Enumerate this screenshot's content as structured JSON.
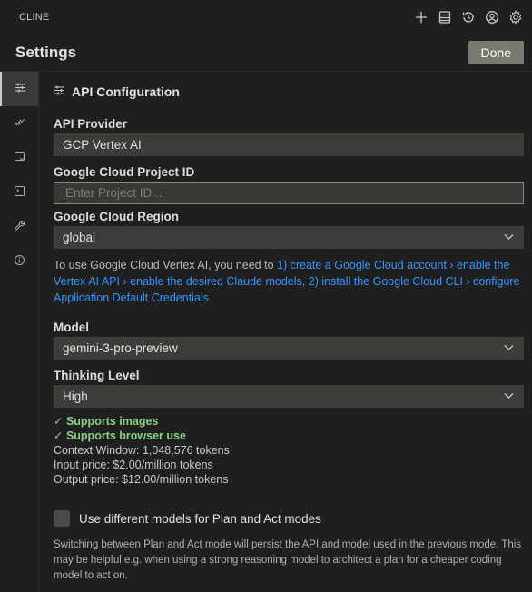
{
  "app": {
    "title": "CLINE"
  },
  "header": {
    "title": "Settings",
    "done_label": "Done"
  },
  "section": {
    "title": "API Configuration"
  },
  "api_provider": {
    "label": "API Provider",
    "value": "GCP Vertex AI"
  },
  "project_id": {
    "label": "Google Cloud Project ID",
    "value": "",
    "placeholder": "Enter Project ID..."
  },
  "region": {
    "label": "Google Cloud Region",
    "value": "global"
  },
  "help": {
    "prefix": "To use Google Cloud Vertex AI, you need to ",
    "link1": "1) create a Google Cloud account › enable the Vertex AI API › enable the desired Claude models,",
    "space": " ",
    "link2": "2) install the Google Cloud CLI › configure Application Default Credentials."
  },
  "model": {
    "label": "Model",
    "value": "gemini-3-pro-preview"
  },
  "thinking": {
    "label": "Thinking Level",
    "value": "High"
  },
  "features": [
    "Supports images",
    "Supports browser use"
  ],
  "specs": {
    "context_window": "Context Window: 1,048,576 tokens",
    "input_price": "Input price: $2.00/million tokens",
    "output_price": "Output price: $12.00/million tokens"
  },
  "plan_act": {
    "label": "Use different models for Plan and Act modes",
    "checked": false,
    "note": "Switching between Plan and Act mode will persist the API and model used in the previous mode. This may be helpful e.g. when using a strong reasoning model to architect a plan for a cheaper coding model to act on."
  },
  "toolbar_icons": [
    "plus-icon",
    "database-icon",
    "history-icon",
    "account-icon",
    "gear-icon"
  ],
  "nav_icons": [
    "sliders-icon",
    "check-icon",
    "message-icon",
    "terminal-icon",
    "wrench-icon",
    "info-icon"
  ],
  "colors": {
    "accent_link": "#3794ff",
    "success": "#89d185",
    "done_button": "#777a6f"
  }
}
